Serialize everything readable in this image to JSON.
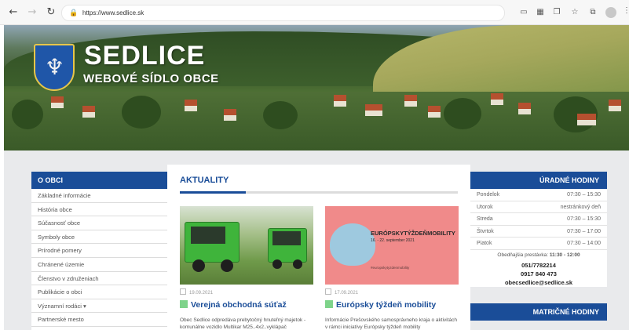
{
  "browser": {
    "url": "https://www.sedlice.sk",
    "icons": [
      "back-icon",
      "forward-icon",
      "reload-icon",
      "lock-icon",
      "reader-icon",
      "grid-icon",
      "tab-icon",
      "favorite-icon",
      "collections-icon",
      "profile-icon",
      "more-icon"
    ]
  },
  "hero": {
    "title": "SEDLICE",
    "subtitle": "WEBOVÉ SÍDLO OBCE"
  },
  "left_menu": {
    "heading": "O OBCI",
    "items": [
      "Základné informácie",
      "História obce",
      "Súčasnosť obce",
      "Symboly obce",
      "Prírodné pomery",
      "Chránené územie",
      "Členstvo v združeniach",
      "Publikácie o obci",
      "Významní rodáci ▾",
      "Partnerské mesto"
    ]
  },
  "news": {
    "heading": "AKTUALITY",
    "items": [
      {
        "date": "19.09.2021",
        "title": "Verejná obchodná súťaž",
        "text": "Obec Sedlice odpredáva prebytočný hnuteľný majetok - komunálne vozidlo Multikar M25..4x2..vyklápač"
      },
      {
        "date": "17.09.2021",
        "title": "Európsky týždeň mobility",
        "text": "Informácie Prešovského samosprávneho kraja o aktivitách v rámci iniciatívy Európsky týždeň mobility"
      }
    ],
    "banner": {
      "title": "EURÓPSKYTÝŽDEŇMOBILITY",
      "date": "16. - 22. september 2021",
      "tag": "#europskytyzdenmobility"
    }
  },
  "office_hours": {
    "heading": "ÚRADNÉ HODINY",
    "rows": [
      {
        "day": "Pondelok",
        "hours": "07:30 – 15:30"
      },
      {
        "day": "Utorok",
        "hours": "nestránkový deň"
      },
      {
        "day": "Streda",
        "hours": "07:30 – 15:30"
      },
      {
        "day": "Štvrtok",
        "hours": "07:30 – 17:00"
      },
      {
        "day": "Piatok",
        "hours": "07:30 – 14:00"
      }
    ],
    "break_label": "Obedňajšia prestávka:",
    "break_time": "11:30 - 12:00",
    "phone1": "051/7782214",
    "phone2": "0917 840 473",
    "email": "obecsedlice@sedlice.sk"
  },
  "registry": {
    "heading": "MATRIČNÉ HODINY"
  },
  "colors": {
    "brand_blue": "#1a4d98",
    "accent_green": "#7ed38a",
    "page_bg": "#e9eaec"
  }
}
